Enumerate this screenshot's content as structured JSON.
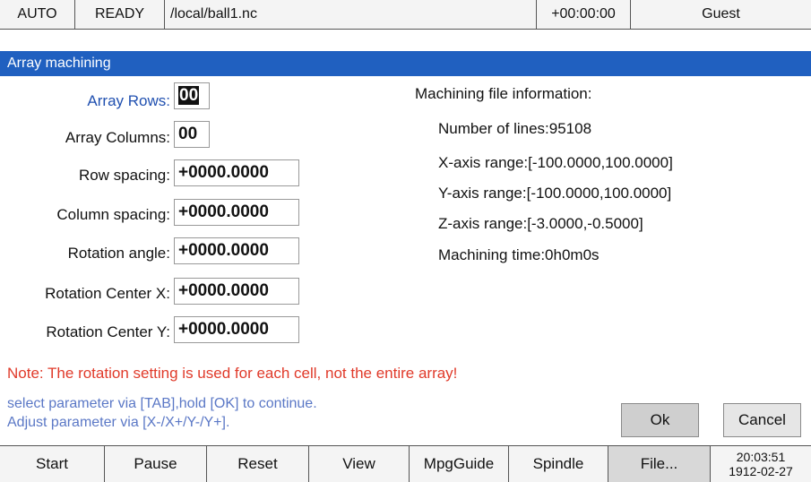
{
  "status": {
    "mode": "AUTO",
    "state": "READY",
    "file": "/local/ball1.nc",
    "time": "+00:00:00",
    "user": "Guest"
  },
  "dialog": {
    "title": "Array machining",
    "params": {
      "array_rows": {
        "label": "Array Rows:",
        "value": "00"
      },
      "array_columns": {
        "label": "Array Columns:",
        "value": "00"
      },
      "row_spacing": {
        "label": "Row spacing:",
        "value": "+0000.0000"
      },
      "column_spacing": {
        "label": "Column spacing:",
        "value": "+0000.0000"
      },
      "rotation_angle": {
        "label": "Rotation angle:",
        "value": "+0000.0000"
      },
      "rotation_center_x": {
        "label": "Rotation Center X:",
        "value": "+0000.0000"
      },
      "rotation_center_y": {
        "label": "Rotation Center Y:",
        "value": "+0000.0000"
      }
    },
    "file_info": {
      "heading": "Machining file information:",
      "lines": "Number of lines:95108",
      "x_range": "X-axis range:[-100.0000,100.0000]",
      "y_range": "Y-axis range:[-100.0000,100.0000]",
      "z_range": "Z-axis range:[-3.0000,-0.5000]",
      "time": "Machining time:0h0m0s"
    },
    "note": "Note: The rotation setting is used for each cell, not the entire array!",
    "hint1": "select parameter via [TAB],hold [OK] to continue.",
    "hint2": "Adjust parameter via [X-/X+/Y-/Y+].",
    "ok_label": "Ok",
    "cancel_label": "Cancel"
  },
  "toolbar": {
    "buttons": [
      "Start",
      "Pause",
      "Reset",
      "View",
      "MpgGuide",
      "Spindle",
      "File..."
    ],
    "clock_time": "20:03:51",
    "clock_date": "1912-02-27"
  }
}
